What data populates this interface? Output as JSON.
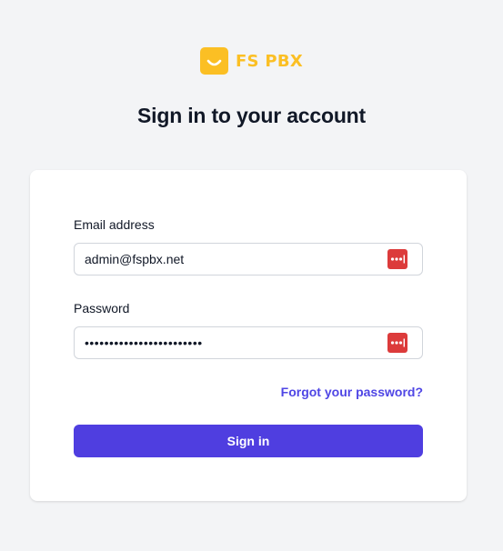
{
  "brand": {
    "name": "FS PBX",
    "color": "#fbbf24",
    "icon": "smile-logo-icon"
  },
  "heading": "Sign in to your account",
  "form": {
    "email": {
      "label": "Email address",
      "value": "admin@fspbx.net",
      "autofill_icon": "password-manager-icon"
    },
    "password": {
      "label": "Password",
      "masked_value": "••••••••••••••••••••••••",
      "autofill_icon": "password-manager-icon"
    },
    "forgot_link": "Forgot your password?",
    "submit_label": "Sign in"
  },
  "colors": {
    "accent": "#4f3ee0",
    "link": "#4f46e5",
    "background": "#f3f4f6",
    "password_manager": "#dc3b3b"
  }
}
